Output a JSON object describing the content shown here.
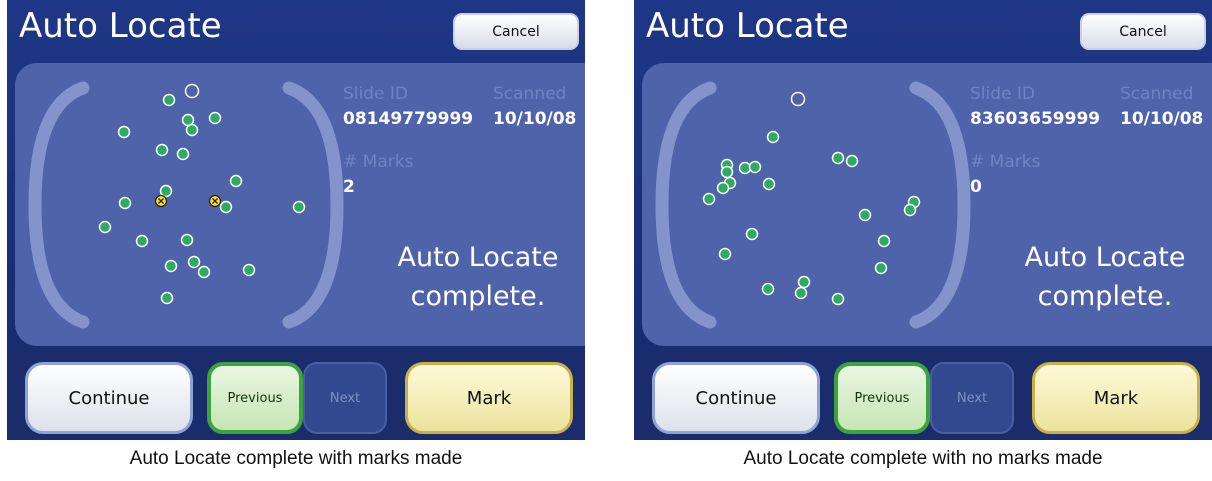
{
  "panels": [
    {
      "title": "Auto Locate",
      "cancel_label": "Cancel",
      "slide_id_label": "Slide ID",
      "slide_id_value": "08149779999",
      "scanned_label": "Scanned",
      "scanned_value": "10/10/08",
      "marks_label": "# Marks",
      "marks_value": "2",
      "status_line1": "Auto Locate",
      "status_line2": "complete.",
      "buttons": {
        "continue": "Continue",
        "previous": "Previous",
        "next": "Next",
        "mark": "Mark"
      },
      "caption": "Auto Locate complete with marks made"
    },
    {
      "title": "Auto Locate",
      "cancel_label": "Cancel",
      "slide_id_label": "Slide ID",
      "slide_id_value": "83603659999",
      "scanned_label": "Scanned",
      "scanned_value": "10/10/08",
      "marks_label": "# Marks",
      "marks_value": "0",
      "status_line1": "Auto Locate",
      "status_line2": "complete.",
      "buttons": {
        "continue": "Continue",
        "previous": "Previous",
        "next": "Next",
        "mark": "Mark"
      },
      "caption": "Auto Locate complete with no marks made"
    }
  ],
  "colors": {
    "screen_background": "#1e3786",
    "content_panel": "#4f63ab",
    "green_dot": "#2faa62",
    "yellow_mark": "#ffe21f",
    "previous_border": "#3ca43c",
    "mark_border": "#c9b14a"
  }
}
